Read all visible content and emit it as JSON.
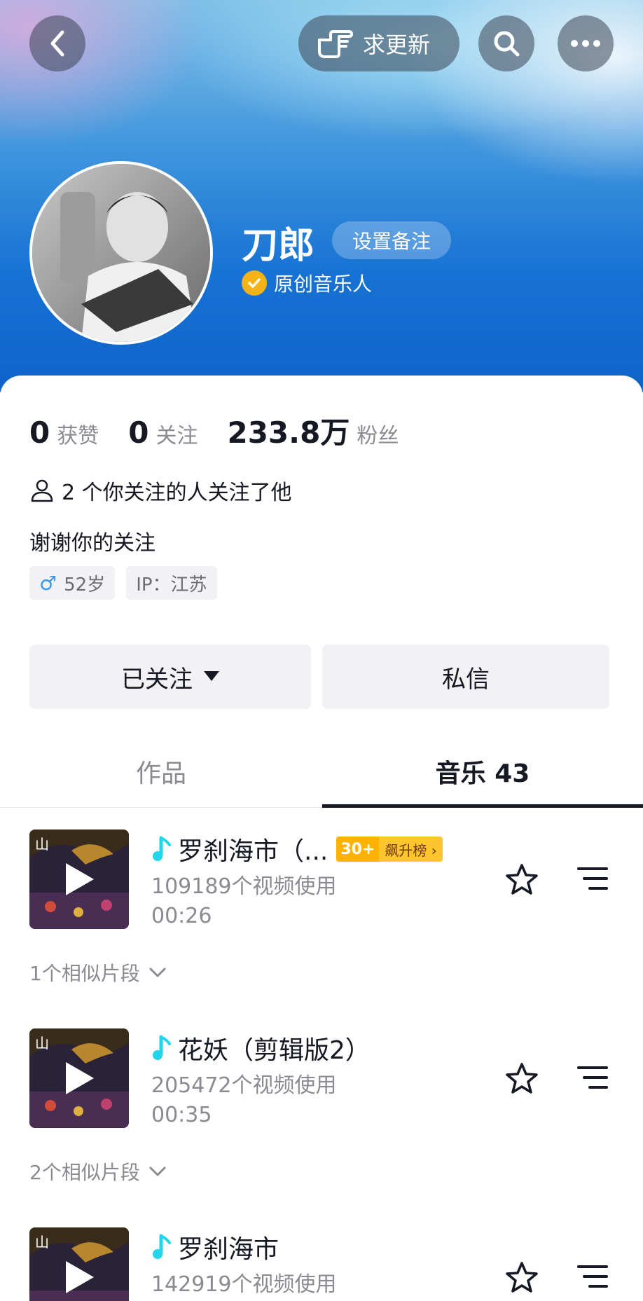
{
  "top_bar": {
    "request_update_label": "求更新"
  },
  "profile": {
    "name": "刀郎",
    "set_remark_label": "设置备注",
    "verification": "原创音乐人"
  },
  "stats": [
    {
      "num": "0",
      "label": "获赞"
    },
    {
      "num": "0",
      "label": "关注"
    },
    {
      "num": "233.8万",
      "label": "粉丝"
    }
  ],
  "mutual_follow": "2 个你关注的人关注了他",
  "bio": "谢谢你的关注",
  "tags": {
    "age": "52岁",
    "ip": "IP：江苏"
  },
  "actions": {
    "followed": "已关注",
    "message": "私信"
  },
  "tabs": {
    "works": "作品",
    "music": "音乐 43"
  },
  "songs": [
    {
      "title": "罗刹海市（...",
      "badge_rank": "30+",
      "badge_text": "飙升榜 ›",
      "usage": "109189个视频使用",
      "duration": "00:26",
      "similar": "1个相似片段"
    },
    {
      "title": "花妖（剪辑版2）",
      "usage": "205472个视频使用",
      "duration": "00:35",
      "similar": "2个相似片段"
    },
    {
      "title": "罗刹海市",
      "usage": "142919个视频使用"
    }
  ],
  "colors": {
    "accent_blue": "#1672d4",
    "note_icon": "#20d5ec",
    "verify_gold": "#f6b318"
  }
}
